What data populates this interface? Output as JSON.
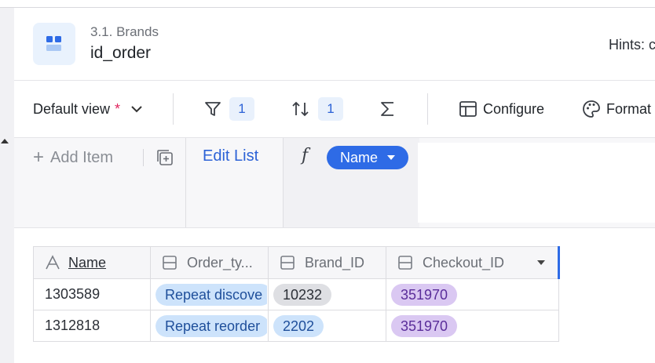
{
  "header": {
    "breadcrumb": "3.1. Brands",
    "title": "id_order",
    "hints_label": "Hints: c"
  },
  "toolbar": {
    "view_label": "Default view",
    "view_modified_marker": "*",
    "filter_count": "1",
    "sort_count": "1",
    "configure_label": "Configure",
    "format_label": "Format"
  },
  "listbar": {
    "add_item_label": "Add Item",
    "edit_list_label": "Edit List",
    "formula_symbol": "f",
    "field_pill_label": "Name"
  },
  "table": {
    "columns": [
      {
        "label": "Name",
        "type_icon": "text-type-icon"
      },
      {
        "label": "Order_ty...",
        "type_icon": "link-type-icon"
      },
      {
        "label": "Brand_ID",
        "type_icon": "link-type-icon"
      },
      {
        "label": "Checkout_ID",
        "type_icon": "link-type-icon"
      }
    ],
    "rows": [
      {
        "name": "1303589",
        "order_type": "Repeat discove",
        "brand_id": "10232",
        "checkout_id": "351970"
      },
      {
        "name": "1312818",
        "order_type": "Repeat reorder",
        "brand_id": "2202",
        "checkout_id": "351970"
      }
    ]
  },
  "colors": {
    "accent": "#2e6be6",
    "chip_blue": "#cde3fb",
    "chip_gray": "#dedfe3",
    "chip_purple": "#dac8f2"
  }
}
